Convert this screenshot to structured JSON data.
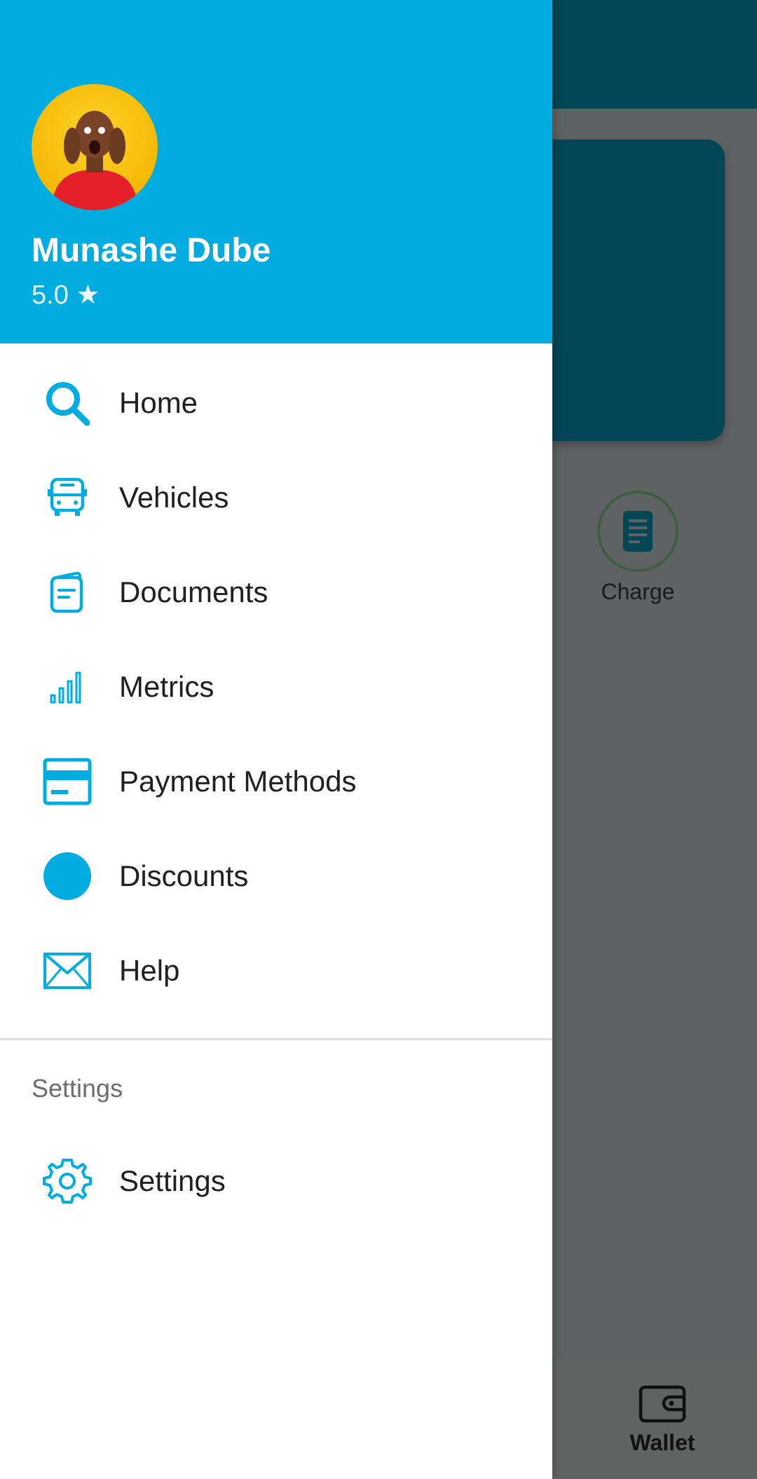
{
  "user": {
    "name": "Munashe Dube",
    "rating": "5.0 ★"
  },
  "menu": {
    "items": [
      {
        "label": "Home",
        "icon": "search-icon"
      },
      {
        "label": "Vehicles",
        "icon": "bus-icon"
      },
      {
        "label": "Documents",
        "icon": "document-icon"
      },
      {
        "label": "Metrics",
        "icon": "bar-chart-icon"
      },
      {
        "label": "Payment Methods",
        "icon": "credit-card-icon"
      },
      {
        "label": "Discounts",
        "icon": "discount-circle-icon"
      },
      {
        "label": "Help",
        "icon": "mail-icon"
      }
    ]
  },
  "settings_section": {
    "title": "Settings",
    "item_label": "Settings"
  },
  "background": {
    "charge_label": "Charge",
    "wallet_label": "Wallet"
  },
  "colors": {
    "accent": "#00ace0",
    "dark_teal": "#034656",
    "overlay": "#5f6263"
  }
}
